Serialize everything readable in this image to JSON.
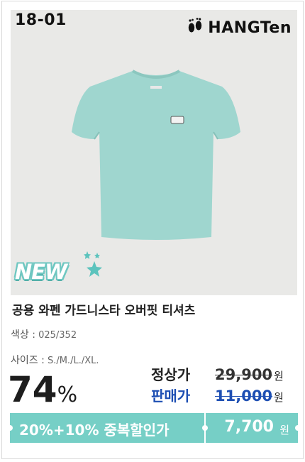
{
  "product_code": "18-01",
  "brand": {
    "name": "HANGTen",
    "logo_icon": "footprints-icon"
  },
  "badge": {
    "label": "NEW",
    "icon": "sparkle-stars-icon"
  },
  "product": {
    "title": "공용 와펜 가드니스타 오버핏 티셔츠",
    "color_label": "색상 :",
    "color_value": "025/352",
    "size_label": "사이즈 :",
    "size_value": "S./M./L./XL."
  },
  "pricing": {
    "discount_rate": "74",
    "discount_symbol": "%",
    "regular_label": "정상가",
    "regular_price": "29,900",
    "sale_label": "판매가",
    "sale_price": "11,000",
    "currency": "원"
  },
  "promo": {
    "text": "20%+10% 중복할인가",
    "final_price": "7,700",
    "currency": "원"
  },
  "colors": {
    "accent": "#76cfc6",
    "shirt": "#9fd6cf",
    "sale_blue": "#1e4fb3",
    "photo_bg": "#e9e9e7"
  }
}
